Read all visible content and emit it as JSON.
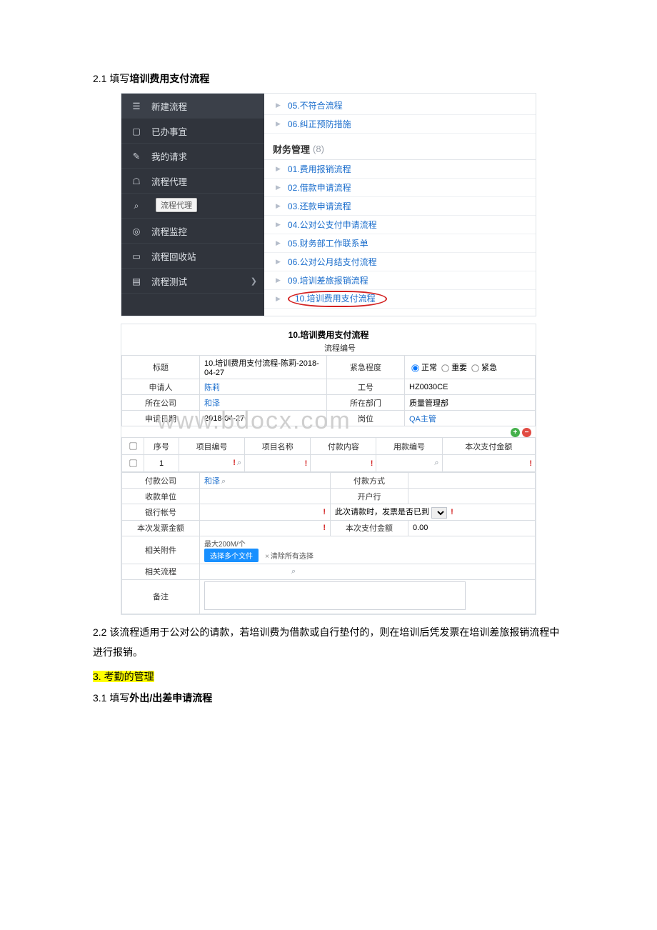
{
  "doc": {
    "s21": "2.1 填写",
    "s21b": "培训费用支付流程",
    "s22": "2.2 该流程适用于公对公的请款，若培训费为借款或自行垫付的，则在培训后凭发票在培训差旅报销流程中进行报销。",
    "s3": "3. 考勤的管理",
    "s31": "3.1 填写",
    "s31b": "外出/出差申请流程"
  },
  "sidebar": {
    "items": [
      {
        "label": "新建流程",
        "icon": "☰",
        "active": true
      },
      {
        "label": "已办事宜",
        "icon": "▢"
      },
      {
        "label": "我的请求",
        "icon": "✎"
      },
      {
        "label": "流程代理",
        "icon": "☖"
      },
      {
        "label": "",
        "icon": "⌕",
        "tooltip": "流程代理"
      },
      {
        "label": "流程监控",
        "icon": "◎"
      },
      {
        "label": "流程回收站",
        "icon": "▭"
      },
      {
        "label": "流程测试",
        "icon": "▤",
        "chev": "❯"
      }
    ]
  },
  "topcat": [
    {
      "label": "05.不符合流程"
    },
    {
      "label": "06.纠正预防措施"
    }
  ],
  "finance": {
    "header": "财务管理",
    "count": "(8)",
    "items": [
      "01.费用报销流程",
      "02.借款申请流程",
      "03.还款申请流程",
      "04.公对公支付申请流程",
      "05.财务部工作联系单",
      "06.公对公月结支付流程",
      "09.培训差旅报销流程",
      "10.培训费用支付流程"
    ]
  },
  "form": {
    "title": "10.培训费用支付流程",
    "processNoLabel": "流程编号",
    "labels": {
      "title": "标题",
      "applicant": "申请人",
      "company": "所在公司",
      "date": "申请日期",
      "urgency": "紧急程度",
      "empno": "工号",
      "dept": "所在部门",
      "post": "岗位"
    },
    "values": {
      "title": "10.培训费用支付流程-陈莉-2018-04-27",
      "applicant": "陈莉",
      "company": "和泽",
      "date": "2018-04-27",
      "empno": "HZ0030CE",
      "dept": "质量管理部",
      "post": "QA主管"
    },
    "urgency": {
      "opts": [
        "正常",
        "重要",
        "紧急"
      ]
    },
    "itemsHeader": {
      "seq": "序号",
      "pno": "项目编号",
      "pname": "项目名称",
      "payc": "付款内容",
      "ucode": "用款编号",
      "amt": "本次支付金额"
    },
    "row1": {
      "seq": "1"
    },
    "lower": {
      "paycompany": "付款公司",
      "paycompany_v": "和泽",
      "paymethod": "付款方式",
      "payee": "收款单位",
      "bank": "开户行",
      "acct": "银行帐号",
      "invoiceQ": "此次请款时，发票是否已到",
      "invoiceAmtLbl": "本次发票金额",
      "thisPayLbl": "本次支付金额",
      "thisPayVal": "0.00",
      "attachLbl": "相关附件",
      "attachMax": "最大200M/个",
      "attachBtn": "选择多个文件",
      "attachClear": "清除所有选择",
      "relFlow": "相关流程",
      "note": "备注"
    }
  },
  "watermark": "www.bdocx.com"
}
